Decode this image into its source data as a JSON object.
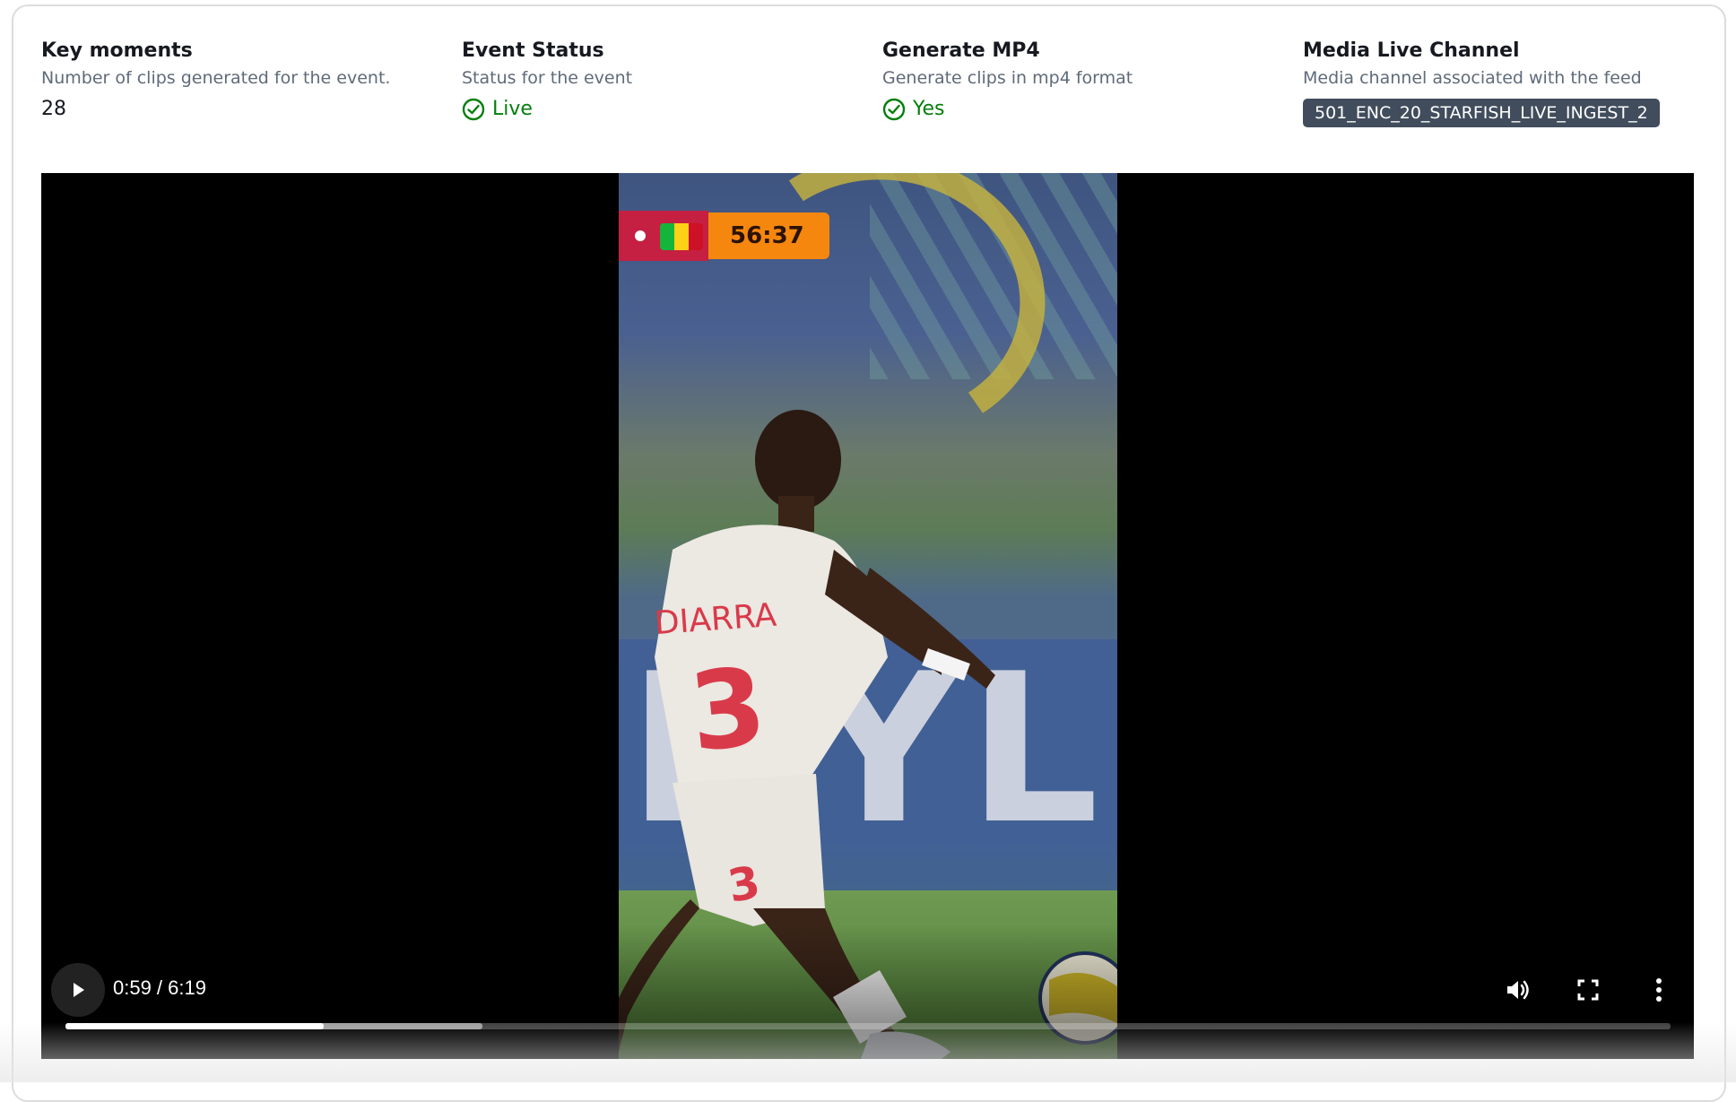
{
  "stats": [
    {
      "title": "Key moments",
      "description": "Number of clips generated for the event.",
      "value": "28"
    },
    {
      "title": "Event Status",
      "description": "Status for the event",
      "value": "Live"
    },
    {
      "title": "Generate MP4",
      "description": "Generate clips in mp4 format",
      "value": "Yes"
    },
    {
      "title": "Media Live Channel",
      "description": "Media channel associated with the feed",
      "value": "501_ENC_20_STARFISH_LIVE_INGEST_2"
    }
  ],
  "video": {
    "scoreboard_clock": "56:37",
    "jersey_name": "DIARRA",
    "jersey_number": "3",
    "board_text": "HYL",
    "time_display": "0:59 / 6:19",
    "progress_played": 0.161,
    "progress_buffered": 0.26,
    "icons": {
      "play": "play-icon",
      "volume": "volume-icon",
      "fullscreen": "fullscreen-icon",
      "more": "more-vertical-icon",
      "status_ok": "check-circle-icon"
    },
    "colors": {
      "status_ok": "#037f0c",
      "badge_bg": "#414d5c",
      "clock_bg": "#f5870f",
      "score_red": "#c51f41"
    }
  }
}
